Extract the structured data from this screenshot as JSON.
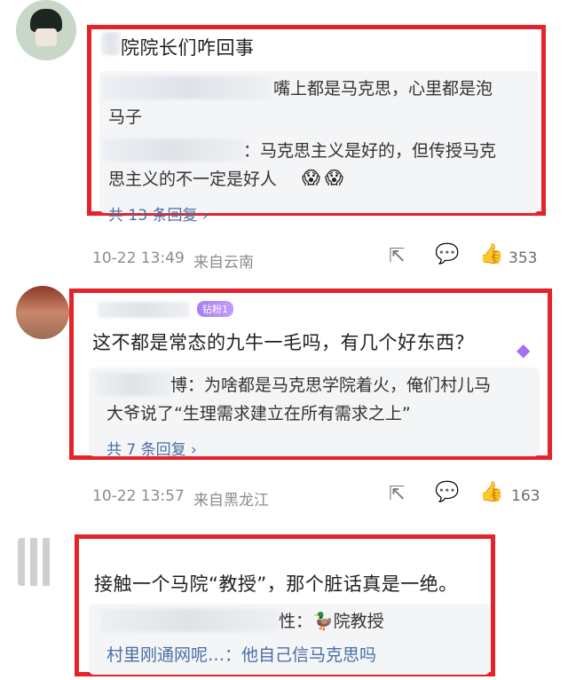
{
  "comments": [
    {
      "text": "院院长们咋回事",
      "replies": [
        {
          "line1": "嘴上都是马克思，心里都是泡",
          "line2": "马子"
        },
        {
          "line1": "：马克思主义是好的，但传授马克",
          "line2": "思主义的不一定是好人"
        }
      ],
      "more_replies": "共 13 条回复 ›",
      "time": "10-22 13:49",
      "location": "来自云南",
      "likes": "353"
    },
    {
      "badge": "钻粉1",
      "text": "这不都是常态的九牛一毛吗，有几个好东西？",
      "replies": [
        {
          "line1": "博：为啥都是马克思学院着火，俺们村儿马",
          "line2": "大爷说了“生理需求建立在所有需求之上”"
        }
      ],
      "more_replies": "共 7 条回复 ›",
      "time": "10-22 13:57",
      "location": "来自黑龙江",
      "likes": "163"
    },
    {
      "text": "接触一个马院“教授”，那个脏话真是一绝。",
      "replies": [
        {
          "line1": "性：🦆院教授"
        },
        {
          "line1": "村里刚通网呢…：他自己信马克思吗"
        }
      ]
    }
  ],
  "icons": {
    "share": "share-icon",
    "comment": "comment-icon",
    "like": "thumbs-up-icon",
    "diamond": "diamond-icon"
  }
}
